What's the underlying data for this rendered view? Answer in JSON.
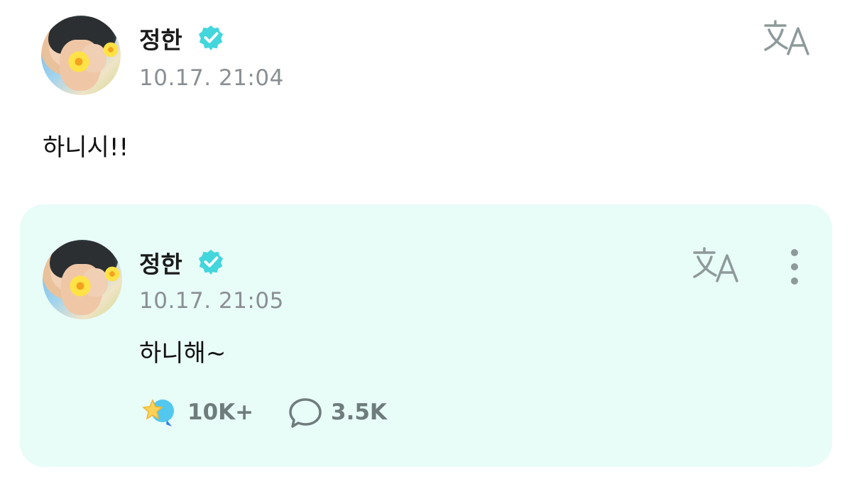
{
  "post": {
    "author": "정한",
    "timestamp": "10.17. 21:04",
    "text": "하니시!!",
    "translate_icon": "translate-icon"
  },
  "comment": {
    "author": "정한",
    "timestamp": "10.17. 21:05",
    "text": "하니해~",
    "translate_icon": "translate-icon",
    "more_icon": "more-vertical-icon",
    "likes": "10K+",
    "comments": "3.5K"
  },
  "colors": {
    "verified": "#43d6dc",
    "card_bg": "#e8fcf8",
    "muted": "#8a8f93",
    "stat_text": "#6f7c7c"
  }
}
